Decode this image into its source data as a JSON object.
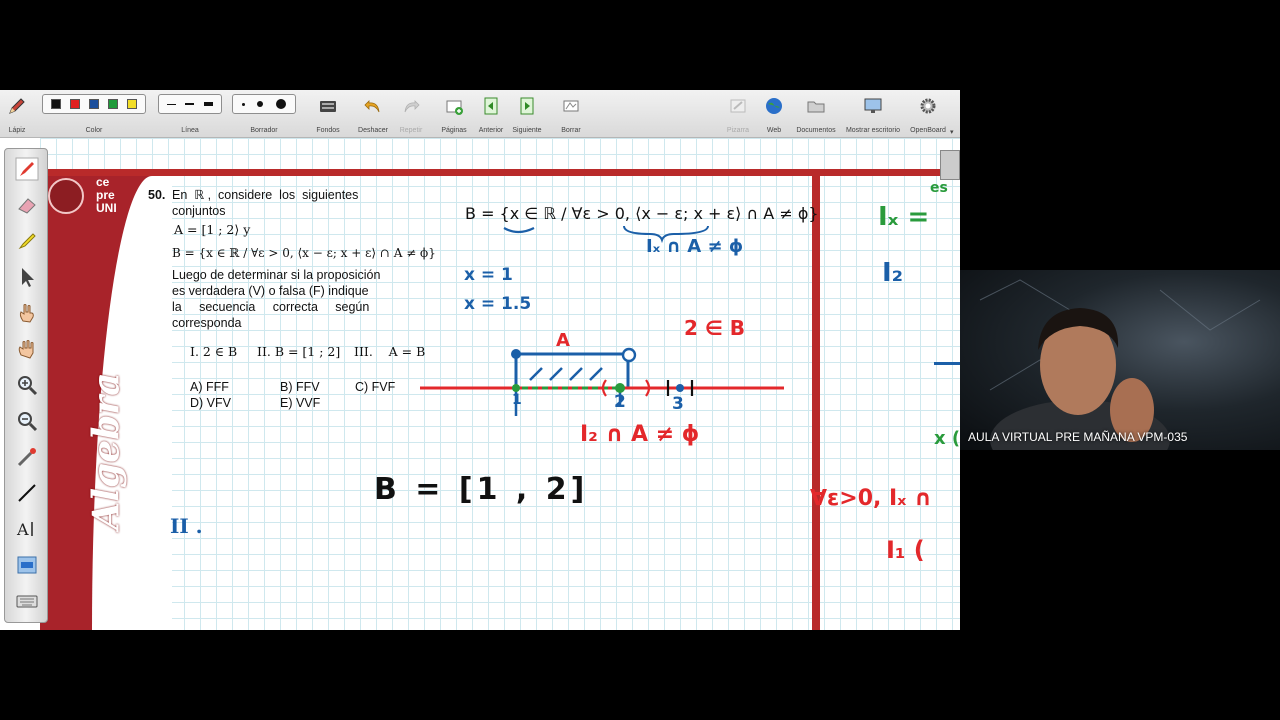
{
  "toolbar": {
    "pencil": "Lápiz",
    "color": "Color",
    "line": "Línea",
    "eraser": "Borrador",
    "backgrounds": "Fondos",
    "undo": "Deshacer",
    "redo": "Repetir",
    "pages": "Páginas",
    "previous": "Anterior",
    "next": "Siguiente",
    "delete": "Borrar",
    "board": "Pizarra",
    "web": "Web",
    "documents": "Documentos",
    "show_desktop": "Mostrar escritorio",
    "openboard": "OpenBoard",
    "colors": [
      "#111111",
      "#e12020",
      "#1c4f9c",
      "#1f9a3a",
      "#f2dd28"
    ]
  },
  "sheet": {
    "logo_text": [
      "ce",
      "pre",
      "UNI"
    ],
    "subject": "Algebra"
  },
  "problem": {
    "number": "50.",
    "line1": "En  ℝ ,  considere  los  siguientes",
    "line2": "conjuntos",
    "setA": "A = [1 ; 2⟩  y",
    "setB": "B = {x ∈ ℝ / ∀ε > 0, ⟨x − ε; x + ε⟩ ∩ A ≠ ϕ}",
    "p1": "Luego de determinar si la proposición",
    "p2": "es verdadera (V) o falsa (F) indique",
    "p3": "la     secuencia     correcta     según",
    "p4": "corresponda",
    "i": "I.  2 ∈ B",
    "ii": "II.  B = [1 ; 2]",
    "iii": "III.    A = B",
    "a": "A) FFF",
    "b": "B) FFV",
    "c": "C) FVF",
    "d": "D) VFV",
    "e": "E) VVF"
  },
  "notes": {
    "setB_copy": "B = {x ∈ ℝ / ∀ε > 0, ⟨x − ε; x + ε⟩ ∩ A ≠ ϕ}",
    "ix_note": "Iₓ  ∩ A ≠ ϕ",
    "x1": "x = 1",
    "x15": "x = 1.5",
    "label_A": "A",
    "two_in_B": "2 ∈ B",
    "tick1": "1",
    "tick2": "2",
    "tick3": "3",
    "i2": "I₂ ∩ A ≠ ϕ",
    "result": "B = [1 , 2]",
    "roman_ii": "II .",
    "right_ix": "Iₓ =",
    "right_i2": "I₂",
    "right_es": "es",
    "right_x": "x (",
    "right_forall": "∀ε>0, Iₓ ∩",
    "right_i1": "I₁ ("
  },
  "webcam": {
    "caption": "AULA VIRTUAL PRE MAÑANA VPM-035"
  }
}
